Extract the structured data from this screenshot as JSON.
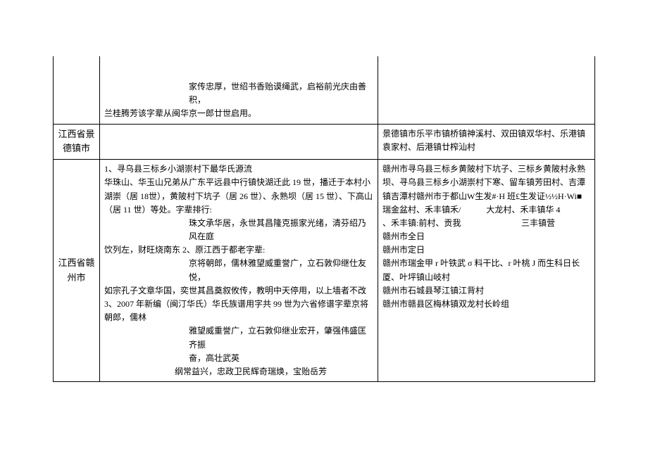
{
  "rows": [
    {
      "province": "",
      "lineage": {
        "spacer": " ",
        "verse1": "家传忠厚，世绍书香贻谟绳武，启裕前光庆由善积，",
        "verse2": "兰桂腾芳该字辈从闽华京一郎廿世启用。"
      },
      "location": ""
    },
    {
      "province": "江西省景德镇市",
      "lineage": "",
      "location": "景德镇市乐平市镇桥镇神溪村、双田镇双华村、乐港镇袁家村、后港镇廿榨汕村"
    },
    {
      "province": "江西省赣州市",
      "lineage": {
        "p1": "1、寻乌县三标乡小湖崇村下最华氏源流",
        "p2": "华珠山、华玉山兄弟从广东平远县中行镇快湖迁此 19 世，播迁于本村小湖崇（居 18世），黄陂村下坑子（居 26 世）、永熟坝（居 15 世）、下高山（居 11 世）等处。字辈排行:",
        "p3_indent": "珠文承华居，永世其昌隆克振家光绪，清芬绍乃风在庭",
        "p4": "饮列左，财旺烧南东 2、原江西于都老字辈:",
        "p5_indent": "京将朝郎，儒林雅望威重誉广，立石敦仰继仕友悦，",
        "p6": "如宗孔子文章华国，奕世其昌奠叙攸传，教明中天停用，以上墙者不改",
        "p7": "3、2007 年新编（闽汀华氏）华氏族谱用字共 99 世为六省修谱字辈京将朝郎，儒林",
        "p8_indent": "雅望威重誉广，立石敦仰继业宏开，肇强伟盛匡齐振",
        "p8b_indent": "奋，高壮武英",
        "p9_indent": "纲常益兴，忠政卫民辉奇瑞焕，宝贻岳芳"
      },
      "location": {
        "l1": "赣州市寻乌县三标乡黄陂村下坑子、三标乡黄陂村永熟坝、寻乌县三标乡小湖崇村下寒、留车镇芳田村、吉潭镇吉潭村赣州市于都山W生发#·H 班£生发证½½H·Wi■瑞金盆村、禾丰镇禾/　　　大龙村、禾丰镇华 4",
        "l2_left": "、禾丰镇:",
        "l2_right": "三丰镇营",
        "l3": "前村、贡我",
        "l4": "赣州市全日",
        "l5": "赣州市定日",
        "l6": "赣州市瑞金甲 r 叶铁武 σ 料干比、r 叶桃 J 而生科日长厦、叶坪镇山岐村",
        "l7": "赣州市石城县琴江镇江背村",
        "l8": "赣州市赣县区梅林镇双龙村长岭组"
      }
    }
  ]
}
